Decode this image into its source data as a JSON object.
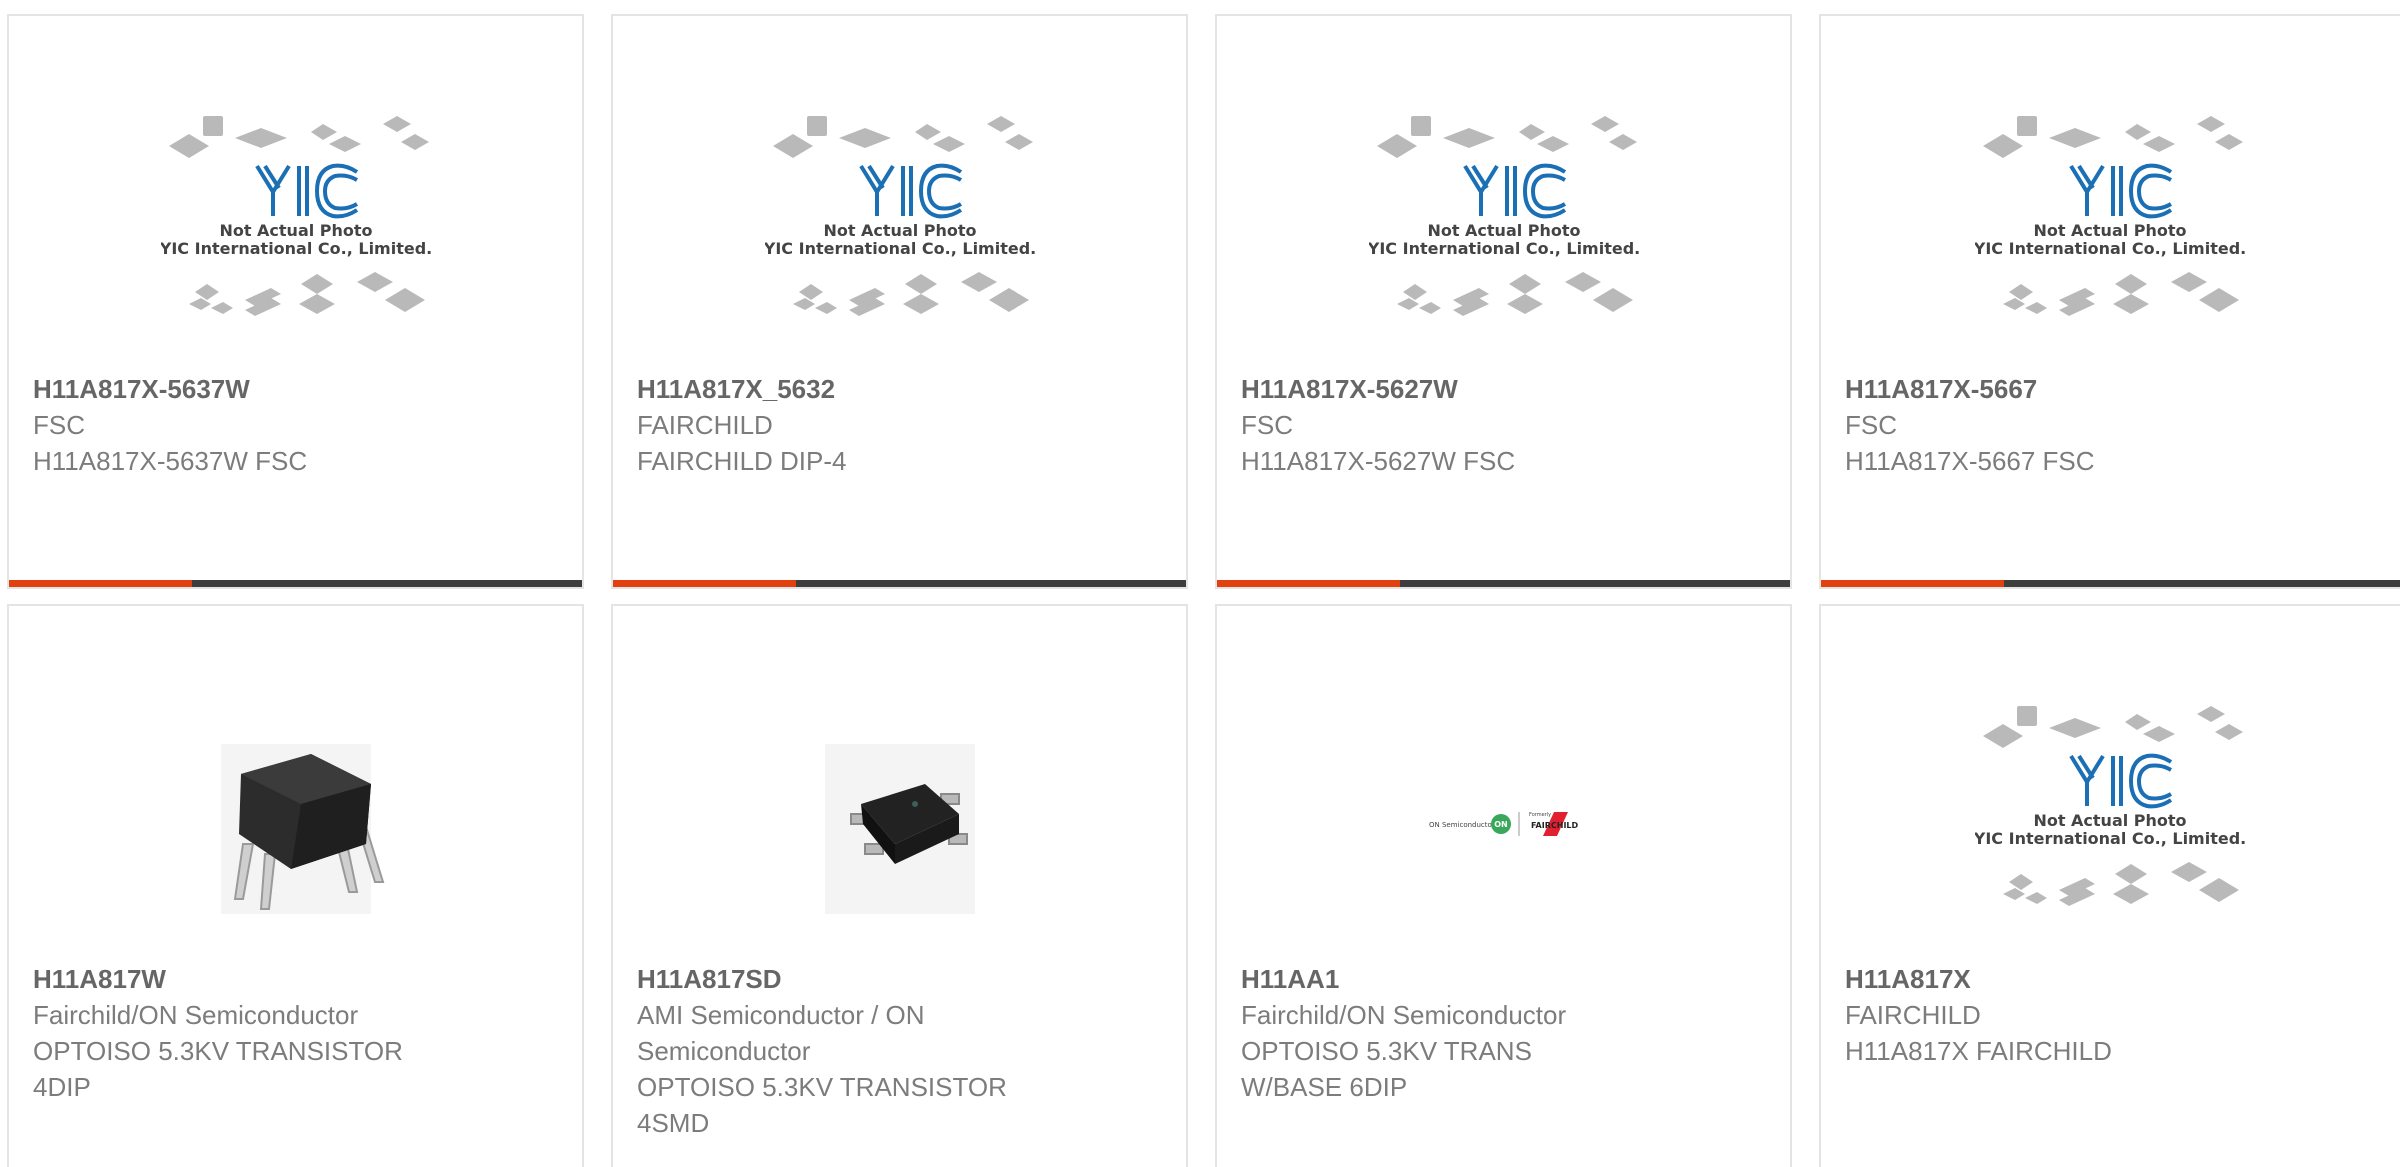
{
  "placeholder": {
    "logo_text": "YIC",
    "caption_line1": "Not Actual Photo",
    "caption_line2": "YIC International Co., Limited."
  },
  "logo_strip": {
    "left_text": "ON Semiconductor",
    "badge": "ON",
    "formerly": "Formerly",
    "right_text": "FAIRCHILD"
  },
  "colors": {
    "accent": "#e0410f",
    "bar": "#3d3d3d",
    "logo_blue": "#1a6fb5"
  },
  "products": [
    {
      "part": "H11A817X-5637W",
      "line1": "FSC",
      "line2": "H11A817X-5637W FSC",
      "line3": "",
      "image": "placeholder"
    },
    {
      "part": "H11A817X_5632",
      "line1": "FAIRCHILD",
      "line2": "FAIRCHILD DIP-4",
      "line3": "",
      "image": "placeholder"
    },
    {
      "part": "H11A817X-5627W",
      "line1": "FSC",
      "line2": "H11A817X-5627W FSC",
      "line3": "",
      "image": "placeholder"
    },
    {
      "part": "H11A817X-5667",
      "line1": "FSC",
      "line2": "H11A817X-5667 FSC",
      "line3": "",
      "image": "placeholder"
    },
    {
      "part": "H11A817W",
      "line1": "Fairchild/ON Semiconductor",
      "line2": "OPTOISO 5.3KV TRANSISTOR",
      "line3": "4DIP",
      "image": "dip-4-package"
    },
    {
      "part": "H11A817SD",
      "line1": "AMI Semiconductor / ON",
      "line2": "Semiconductor",
      "line3": "OPTOISO 5.3KV TRANSISTOR",
      "line4": "4SMD",
      "image": "smd-4-package"
    },
    {
      "part": "H11AA1",
      "line1": "Fairchild/ON Semiconductor",
      "line2": "OPTOISO 5.3KV TRANS",
      "line3": "W/BASE 6DIP",
      "image": "brand-logos"
    },
    {
      "part": "H11A817X",
      "line1": "FAIRCHILD",
      "line2": "H11A817X FAIRCHILD",
      "line3": "",
      "image": "placeholder"
    }
  ]
}
